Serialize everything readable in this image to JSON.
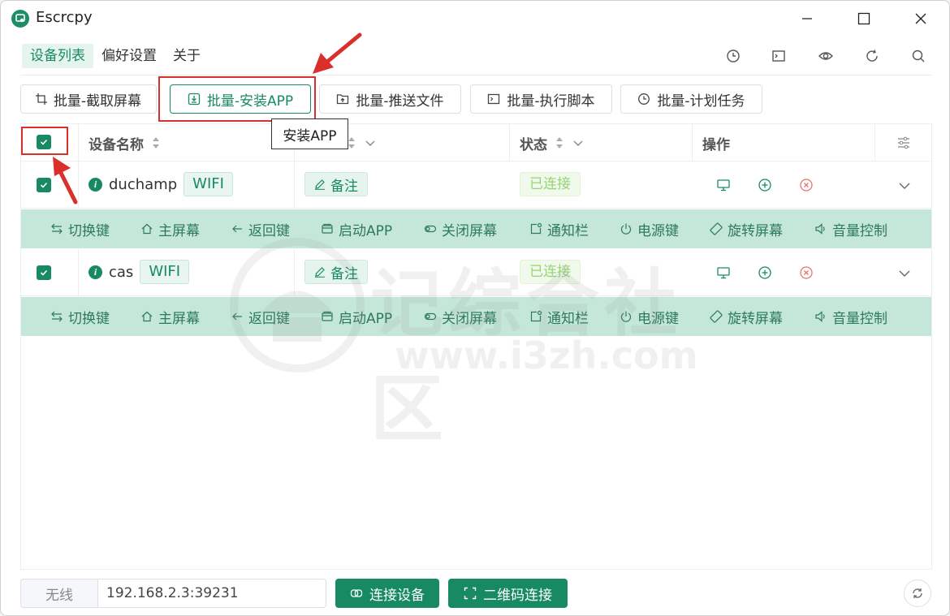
{
  "window": {
    "title": "Escrcpy"
  },
  "menu": {
    "tabs": [
      "设备列表",
      "偏好设置",
      "关于"
    ]
  },
  "batch": {
    "screenshot": "批量-截取屏幕",
    "install_app": "批量-安装APP",
    "push_file": "批量-推送文件",
    "run_script": "批量-执行脚本",
    "schedule_task": "批量-计划任务"
  },
  "tooltip": "安装APP",
  "table": {
    "headers": {
      "device_name": "设备名称",
      "status": "状态",
      "actions": "操作"
    },
    "rows": [
      {
        "name": "duchamp",
        "conn_type": "WIFI",
        "note": "备注",
        "status": "已连接"
      },
      {
        "name": "cas",
        "conn_type": "WIFI",
        "note": "备注",
        "status": "已连接"
      }
    ],
    "action_labels": [
      "切换键",
      "主屏幕",
      "返回键",
      "启动APP",
      "关闭屏幕",
      "通知栏",
      "电源键",
      "旋转屏幕",
      "音量控制"
    ]
  },
  "watermark": {
    "text_cn": "记综合社区",
    "text_url": "www.i3zh.com"
  },
  "bottom": {
    "mode": "无线",
    "address": "192.168.2.3:39231",
    "connect_label": "连接设备",
    "qr_label": "二维码连接"
  },
  "colors": {
    "accent": "#178a63",
    "action_bar": "#c5e7da",
    "highlight_red": "#d9302c",
    "status_text": "#95d475"
  }
}
